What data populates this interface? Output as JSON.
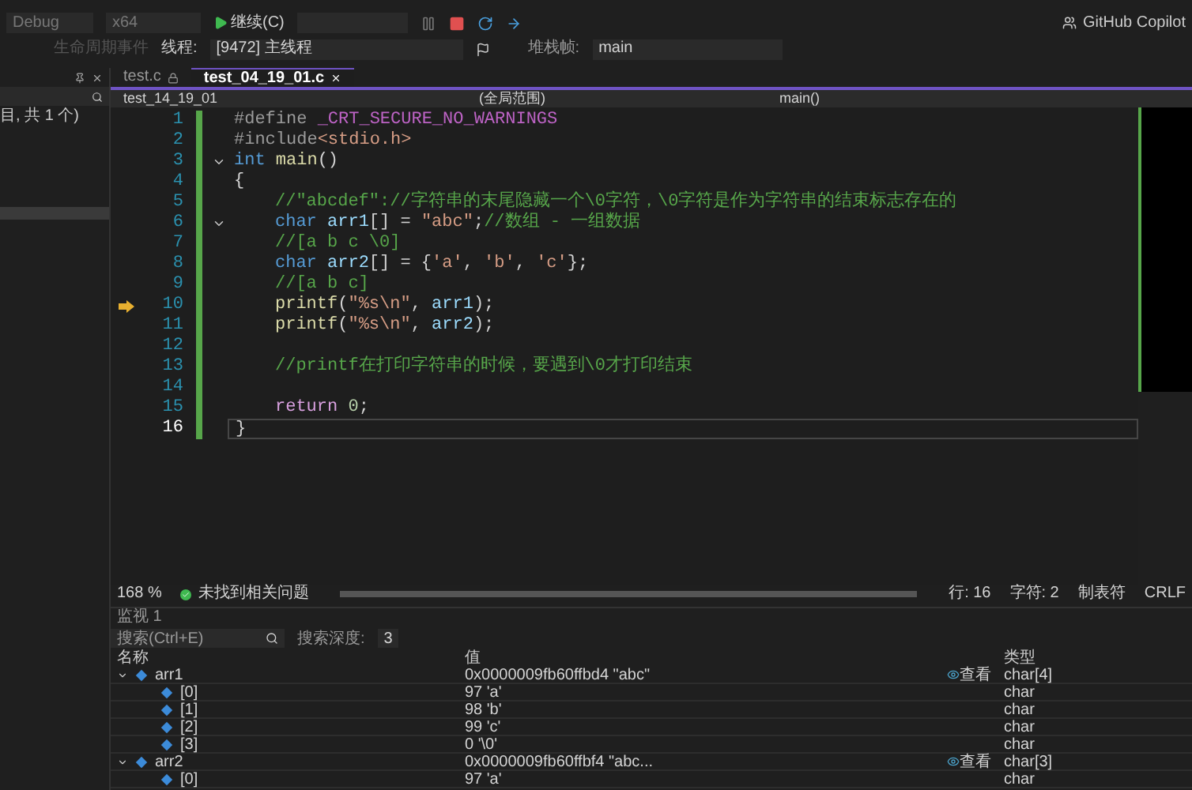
{
  "toolbar": {
    "configuration": "Debug",
    "platform": "x64",
    "continue_button": "继续(C)",
    "copilot": "GitHub Copilot"
  },
  "debug_location": {
    "lifecycle": "生命周期事件",
    "thread_label": "线程:",
    "thread": "[9472] 主线程",
    "stack_label": "堆栈帧:",
    "stack": "main"
  },
  "side_panel": {
    "summary": "目, 共 1 个)"
  },
  "tabs": [
    {
      "label": "test.c",
      "selected": false,
      "locked": true
    },
    {
      "label": "test_04_19_01.c",
      "selected": true,
      "locked": false
    }
  ],
  "nav_bar": {
    "project": "test_14_19_01",
    "scope": "(全局范围)",
    "member": "main()"
  },
  "code_lines": [
    {
      "number": "1",
      "fold": false,
      "execution_point": false,
      "current": false,
      "indented": false,
      "tokens": [
        {
          "kind": "preproc",
          "text": "#define "
        },
        {
          "kind": "macro",
          "text": "_CRT_SECURE_NO_WARNINGS"
        }
      ]
    },
    {
      "number": "2",
      "fold": false,
      "execution_point": false,
      "current": false,
      "indented": false,
      "tokens": [
        {
          "kind": "preproc",
          "text": "#include"
        },
        {
          "kind": "string",
          "text": "<stdio.h>"
        }
      ]
    },
    {
      "number": "3",
      "fold": true,
      "execution_point": false,
      "current": false,
      "indented": false,
      "tokens": [
        {
          "kind": "keyword",
          "text": "int "
        },
        {
          "kind": "function",
          "text": "main"
        },
        {
          "kind": "plain",
          "text": "()"
        }
      ]
    },
    {
      "number": "4",
      "fold": false,
      "execution_point": false,
      "current": false,
      "indented": false,
      "tokens": [
        {
          "kind": "plain",
          "text": "{"
        }
      ]
    },
    {
      "number": "5",
      "fold": false,
      "execution_point": false,
      "current": false,
      "indented": true,
      "tokens": [
        {
          "kind": "comment",
          "text": "//\"abcdef\"://字符串的末尾隐藏一个\\0字符，\\0字符是作为字符串的结束标志存在的"
        }
      ]
    },
    {
      "number": "6",
      "fold": true,
      "execution_point": false,
      "current": false,
      "indented": true,
      "tokens": [
        {
          "kind": "keyword",
          "text": "char "
        },
        {
          "kind": "variable",
          "text": "arr1"
        },
        {
          "kind": "plain",
          "text": "[] = "
        },
        {
          "kind": "string",
          "text": "\"abc\""
        },
        {
          "kind": "plain",
          "text": ";"
        },
        {
          "kind": "comment",
          "text": "//数组 - 一组数据"
        }
      ]
    },
    {
      "number": "7",
      "fold": false,
      "execution_point": false,
      "current": false,
      "indented": true,
      "tokens": [
        {
          "kind": "comment",
          "text": "//[a b c \\0]"
        }
      ]
    },
    {
      "number": "8",
      "fold": false,
      "execution_point": false,
      "current": false,
      "indented": true,
      "tokens": [
        {
          "kind": "keyword",
          "text": "char "
        },
        {
          "kind": "variable",
          "text": "arr2"
        },
        {
          "kind": "plain",
          "text": "[] = {"
        },
        {
          "kind": "string",
          "text": "'a'"
        },
        {
          "kind": "plain",
          "text": ", "
        },
        {
          "kind": "string",
          "text": "'b'"
        },
        {
          "kind": "plain",
          "text": ", "
        },
        {
          "kind": "string",
          "text": "'c'"
        },
        {
          "kind": "plain",
          "text": "};"
        }
      ]
    },
    {
      "number": "9",
      "fold": false,
      "execution_point": false,
      "current": false,
      "indented": true,
      "tokens": [
        {
          "kind": "comment",
          "text": "//[a b c]"
        }
      ]
    },
    {
      "number": "10",
      "fold": false,
      "execution_point": true,
      "current": false,
      "indented": true,
      "tokens": [
        {
          "kind": "function",
          "text": "printf"
        },
        {
          "kind": "plain",
          "text": "("
        },
        {
          "kind": "string",
          "text": "\"%s\\n\""
        },
        {
          "kind": "plain",
          "text": ", "
        },
        {
          "kind": "variable",
          "text": "arr1"
        },
        {
          "kind": "plain",
          "text": ");"
        }
      ]
    },
    {
      "number": "11",
      "fold": false,
      "execution_point": false,
      "current": false,
      "indented": true,
      "tokens": [
        {
          "kind": "function",
          "text": "printf"
        },
        {
          "kind": "plain",
          "text": "("
        },
        {
          "kind": "string",
          "text": "\"%s\\n\""
        },
        {
          "kind": "plain",
          "text": ", "
        },
        {
          "kind": "variable",
          "text": "arr2"
        },
        {
          "kind": "plain",
          "text": ");"
        }
      ]
    },
    {
      "number": "12",
      "fold": false,
      "execution_point": false,
      "current": false
    },
    {
      "number": "13",
      "fold": false,
      "execution_point": false,
      "current": false,
      "indented": true,
      "tokens": [
        {
          "kind": "comment",
          "text": "//printf在打印字符串的时候，要遇到\\0才打印结束"
        }
      ]
    },
    {
      "number": "14",
      "fold": false,
      "execution_point": false,
      "current": false
    },
    {
      "number": "15",
      "fold": false,
      "execution_point": false,
      "current": false,
      "indented": true,
      "tokens": [
        {
          "kind": "control",
          "text": "return "
        },
        {
          "kind": "number",
          "text": "0"
        },
        {
          "kind": "plain",
          "text": ";"
        }
      ]
    },
    {
      "number": "16",
      "fold": false,
      "execution_point": false,
      "current": true,
      "indented": false,
      "tokens": [
        {
          "kind": "plain",
          "text": "}"
        }
      ]
    }
  ],
  "status_bar": {
    "zoom": "168 %",
    "issues": "未找到相关问题",
    "line": "行: 16",
    "char": "字符: 2",
    "indent": "制表符",
    "eol": "CRLF"
  },
  "watch": {
    "title": "监视 1",
    "search_placeholder": "搜索(Ctrl+E)",
    "depth_label": "搜索深度:",
    "depth": "3",
    "columns": [
      "名称",
      "值",
      "类型"
    ],
    "rows": [
      {
        "name": "arr1",
        "value": "0x0000009fb60ffbd4 \"abc\"",
        "type": "char[4]",
        "view": "查看",
        "expanded": true,
        "children": [
          {
            "name": "[0]",
            "value": "97 'a'",
            "type": "char"
          },
          {
            "name": "[1]",
            "value": "98 'b'",
            "type": "char"
          },
          {
            "name": "[2]",
            "value": "99 'c'",
            "type": "char"
          },
          {
            "name": "[3]",
            "value": "0 '\\0'",
            "type": "char"
          }
        ]
      },
      {
        "name": "arr2",
        "value": "0x0000009fb60ffbf4 \"abc...",
        "type": "char[3]",
        "view": "查看",
        "expanded": true,
        "children": [
          {
            "name": "[0]",
            "value": "97 'a'",
            "type": "char"
          }
        ]
      }
    ]
  }
}
